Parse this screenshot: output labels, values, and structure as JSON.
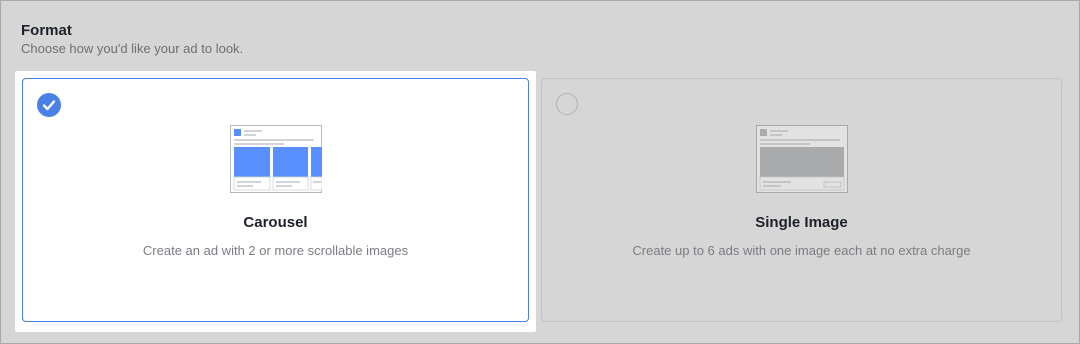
{
  "format": {
    "title": "Format",
    "subtitle": "Choose how you'd like your ad to look."
  },
  "options": [
    {
      "title": "Carousel",
      "description": "Create an ad with 2 or more scrollable images",
      "selected": true,
      "icon": "carousel-preview-icon"
    },
    {
      "title": "Single Image",
      "description": "Create up to 6 ads with one image each at no extra charge",
      "selected": false,
      "icon": "single-image-preview-icon"
    }
  ],
  "colors": {
    "accent": "#4a80e8",
    "background": "#d6d6d6",
    "selected_card": "#ffffff"
  }
}
